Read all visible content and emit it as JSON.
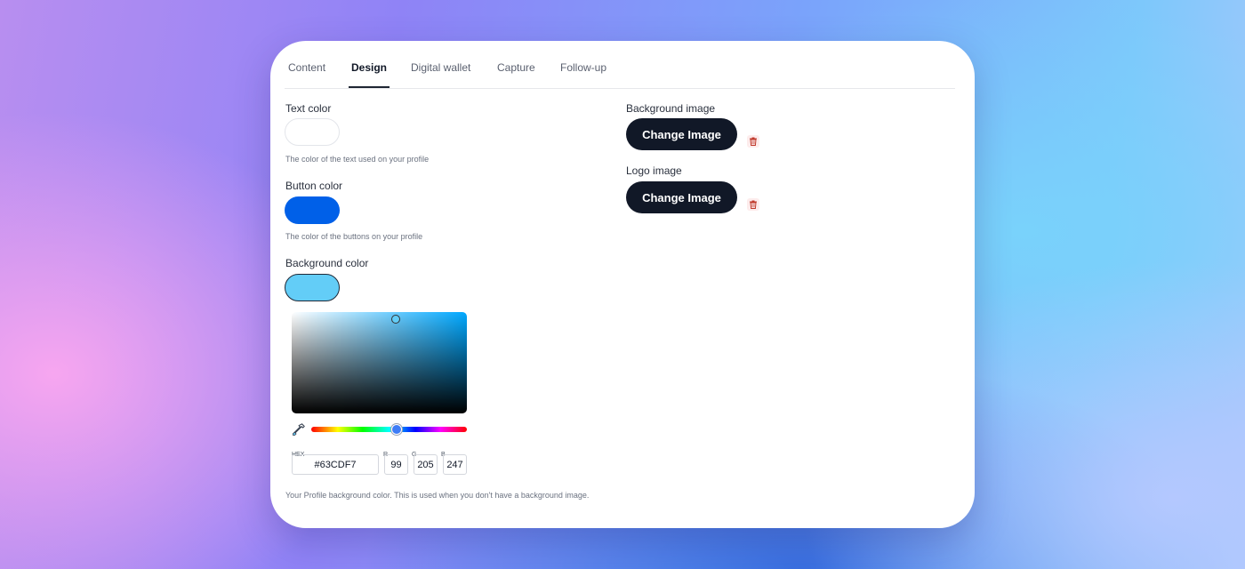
{
  "tabs": [
    {
      "label": "Content",
      "active": false
    },
    {
      "label": "Design",
      "active": true
    },
    {
      "label": "Digital wallet",
      "active": false
    },
    {
      "label": "Capture",
      "active": false
    },
    {
      "label": "Follow-up",
      "active": false
    }
  ],
  "text_color": {
    "label": "Text color",
    "value": "#FFFFFF",
    "help": "The color of the text used on your profile"
  },
  "button_color": {
    "label": "Button color",
    "value": "#0060E8",
    "help": "The color of the buttons on your profile"
  },
  "background_color": {
    "label": "Background color",
    "value": "#63CDF7",
    "help": "Your Profile background color. This is used when you don't have a background image."
  },
  "picker": {
    "hex_label": "HEX",
    "hex": "#63CDF7",
    "r_label": "R",
    "r": "99",
    "g_label": "G",
    "g": "205",
    "b_label": "B",
    "b": "247",
    "icons": {
      "eyedropper": "eyedropper-icon"
    }
  },
  "background_image": {
    "label": "Background image",
    "button": "Change Image",
    "delete_icon": "trash-icon"
  },
  "logo_image": {
    "label": "Logo image",
    "button": "Change Image",
    "delete_icon": "trash-icon"
  },
  "colors": {
    "accent_dark": "#111827",
    "delete_red": "#c0392b"
  }
}
